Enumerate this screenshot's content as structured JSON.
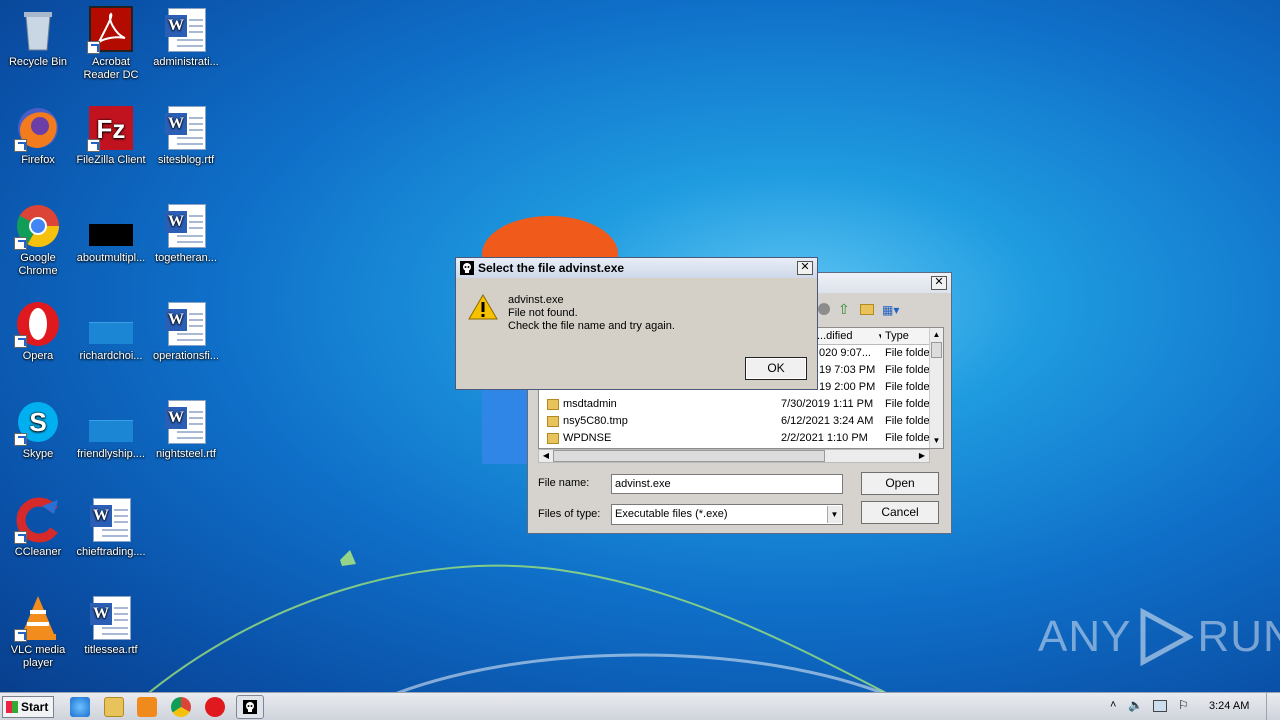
{
  "desktop": {
    "icons": [
      {
        "label": "Recycle Bin"
      },
      {
        "label": "Acrobat Reader DC"
      },
      {
        "label": "administrati..."
      },
      {
        "label": "Firefox"
      },
      {
        "label": "FileZilla Client"
      },
      {
        "label": "sitesblog.rtf"
      },
      {
        "label": "Google Chrome"
      },
      {
        "label": "aboutmultipl..."
      },
      {
        "label": "togetheran..."
      },
      {
        "label": "Opera"
      },
      {
        "label": "richardchoi..."
      },
      {
        "label": "operationsfi..."
      },
      {
        "label": "Skype"
      },
      {
        "label": "friendlyship...."
      },
      {
        "label": "nightsteel.rtf"
      },
      {
        "label": "CCleaner"
      },
      {
        "label": "chieftrading...."
      },
      {
        "label": "VLC media player"
      },
      {
        "label": "titlessea.rtf"
      }
    ]
  },
  "open_dialog": {
    "columns": {
      "modified": "...dified",
      "type": "Type"
    },
    "rows": [
      {
        "name": "",
        "date": "020 9:07...",
        "type": "File folde"
      },
      {
        "name": "",
        "date": "19 7:03 PM",
        "type": "File folde"
      },
      {
        "name": "",
        "date": "19 2:00 PM",
        "type": "File folde"
      },
      {
        "name": "msdtadmin",
        "date": "7/30/2019 1:11 PM",
        "type": "File folde"
      },
      {
        "name": "nsy5C80.tmp",
        "date": "6/12/2021 3:24 AM",
        "type": "File folde"
      },
      {
        "name": "WPDNSE",
        "date": "2/2/2021 1:10 PM",
        "type": "File folde"
      }
    ],
    "file_name_label": "File name:",
    "file_name_value": "advinst.exe",
    "files_of_type_label": "Files of type:",
    "files_of_type_value": "Executable files (*.exe)",
    "open_button": "Open",
    "cancel_button": "Cancel"
  },
  "error_dialog": {
    "title": "Select the file advinst.exe",
    "line1": "advinst.exe",
    "line2": "File not found.",
    "line3": "Check the file name and try again.",
    "ok_button": "OK"
  },
  "watermark": {
    "left": "ANY",
    "right": "RUN"
  },
  "taskbar": {
    "start_label": "Start",
    "clock": "3:24 AM"
  }
}
